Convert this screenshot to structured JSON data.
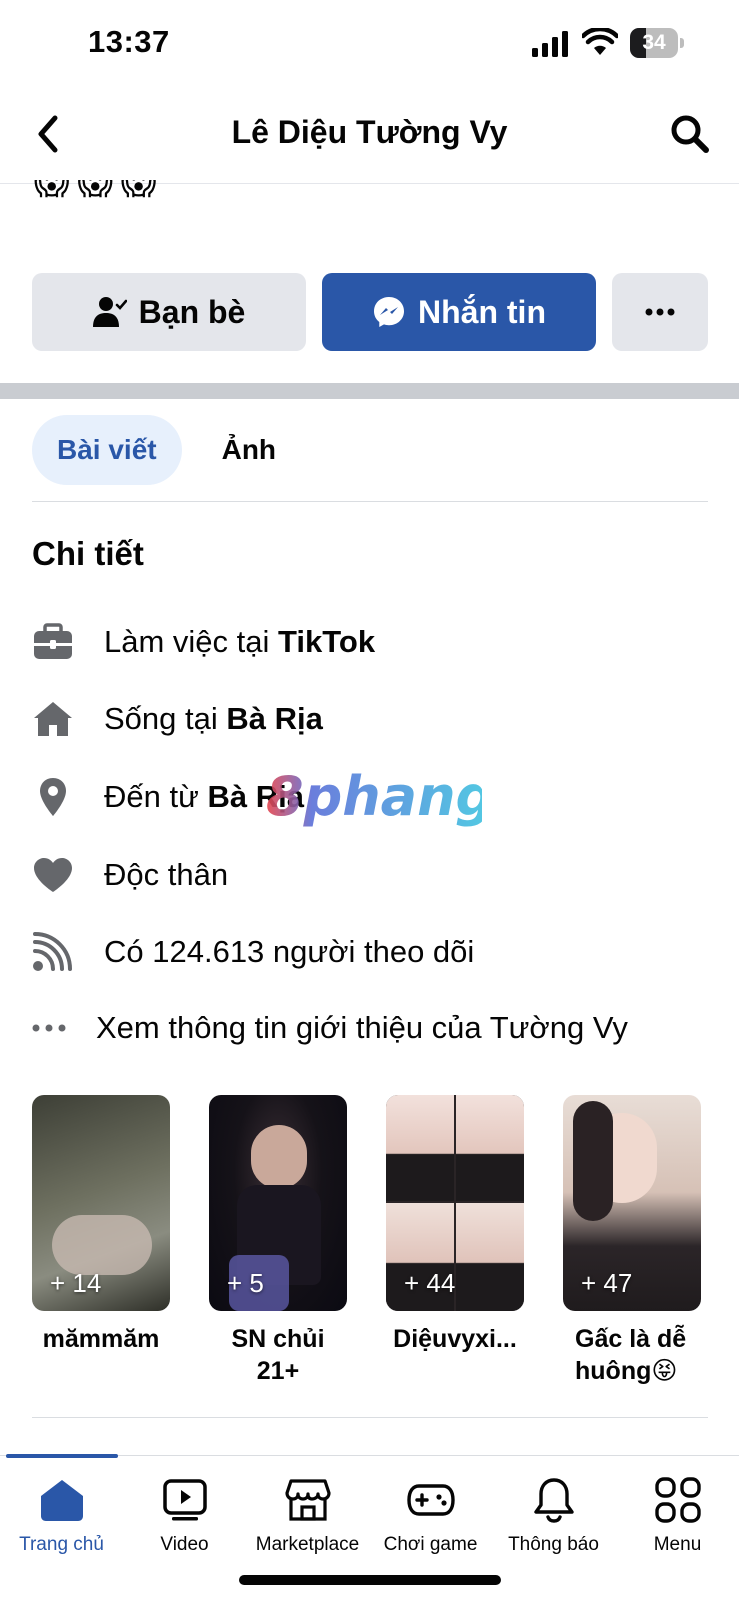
{
  "status_bar": {
    "time": "13:37",
    "battery_level": "34",
    "battery_fraction": 0.34
  },
  "header": {
    "title": "Lê Diệu Tường Vy",
    "back_icon": "chevron-left-icon",
    "search_icon": "search-icon"
  },
  "bio_emojis": [
    "😱",
    "😱",
    "😱"
  ],
  "actions": {
    "friends_label": "Bạn bè",
    "message_label": "Nhắn tin",
    "more_label": "•••"
  },
  "tabs": [
    {
      "label": "Bài viết",
      "active": true
    },
    {
      "label": "Ảnh",
      "active": false
    }
  ],
  "details": {
    "title": "Chi tiết",
    "items": [
      {
        "icon": "briefcase-icon",
        "prefix": "Làm việc tại ",
        "bold": "TikTok"
      },
      {
        "icon": "home-icon",
        "prefix": "Sống tại ",
        "bold": "Bà Rịa"
      },
      {
        "icon": "location-pin-icon",
        "prefix": "Đến từ ",
        "bold": "Bà Rịa"
      },
      {
        "icon": "heart-icon",
        "prefix": "Độc thân",
        "bold": ""
      },
      {
        "icon": "rss-icon",
        "prefix": "Có 124.613 người theo dõi",
        "bold": ""
      },
      {
        "icon": "more-dots-icon",
        "prefix": "Xem thông tin giới thiệu của Tường Vy",
        "bold": ""
      }
    ]
  },
  "watermark": {
    "text": "8phang"
  },
  "highlights": [
    {
      "count": "+ 14",
      "label": "mămmăm",
      "color_a": "#3d3f36",
      "color_b": "#8a8c80"
    },
    {
      "count": "+ 5",
      "label": "SN chủi 21+",
      "color_a": "#0b0a12",
      "color_b": "#4a3f6e"
    },
    {
      "count": "+ 44",
      "label": "Diệuvyxi...",
      "color_a": "#f2e1dc",
      "color_b": "#2a2426"
    },
    {
      "count": "+ 47",
      "label": "Gấc là dễ huông😝",
      "color_a": "#e8ddd6",
      "color_b": "#2b2528"
    }
  ],
  "tab_bar": {
    "items": [
      {
        "label": "Trang chủ",
        "icon": "home-filled-icon",
        "active": true
      },
      {
        "label": "Video",
        "icon": "video-icon",
        "active": false
      },
      {
        "label": "Marketplace",
        "icon": "marketplace-icon",
        "active": false
      },
      {
        "label": "Chơi game",
        "icon": "gamepad-icon",
        "active": false
      },
      {
        "label": "Thông báo",
        "icon": "bell-icon",
        "active": false
      },
      {
        "label": "Menu",
        "icon": "grid-menu-icon",
        "active": false
      }
    ]
  },
  "colors": {
    "accent": "#2a57a8",
    "button_gray": "#e4e6eb",
    "tab_active_bg": "#e7f0fc"
  }
}
